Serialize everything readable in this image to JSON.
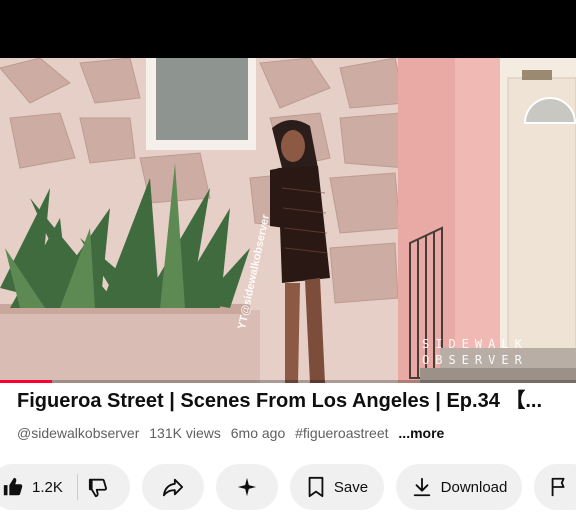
{
  "video": {
    "watermark_line1": "SIDEWALK",
    "watermark_line2": "OBSERVER",
    "vertical_handle": "YT@sidewalkobserver",
    "progress_fraction": 0.09
  },
  "title": "Figueroa Street | Scenes From Los Angeles | Ep.34 【...",
  "meta": {
    "channel": "@sidewalkobserver",
    "views": "131K views",
    "age": "6mo ago",
    "hashtag": "#figueroastreet",
    "more": "...more"
  },
  "actions": {
    "like_count": "1.2K",
    "save_label": "Save",
    "download_label": "Download"
  },
  "icons": [
    "thumbs-up-icon",
    "thumbs-down-icon",
    "share-icon",
    "sparkle-icon",
    "bookmark-icon",
    "download-icon",
    "flag-icon"
  ],
  "colors": {
    "progress": "#ff0033",
    "pill_bg": "#f0f0f0",
    "meta_text": "#606060"
  }
}
